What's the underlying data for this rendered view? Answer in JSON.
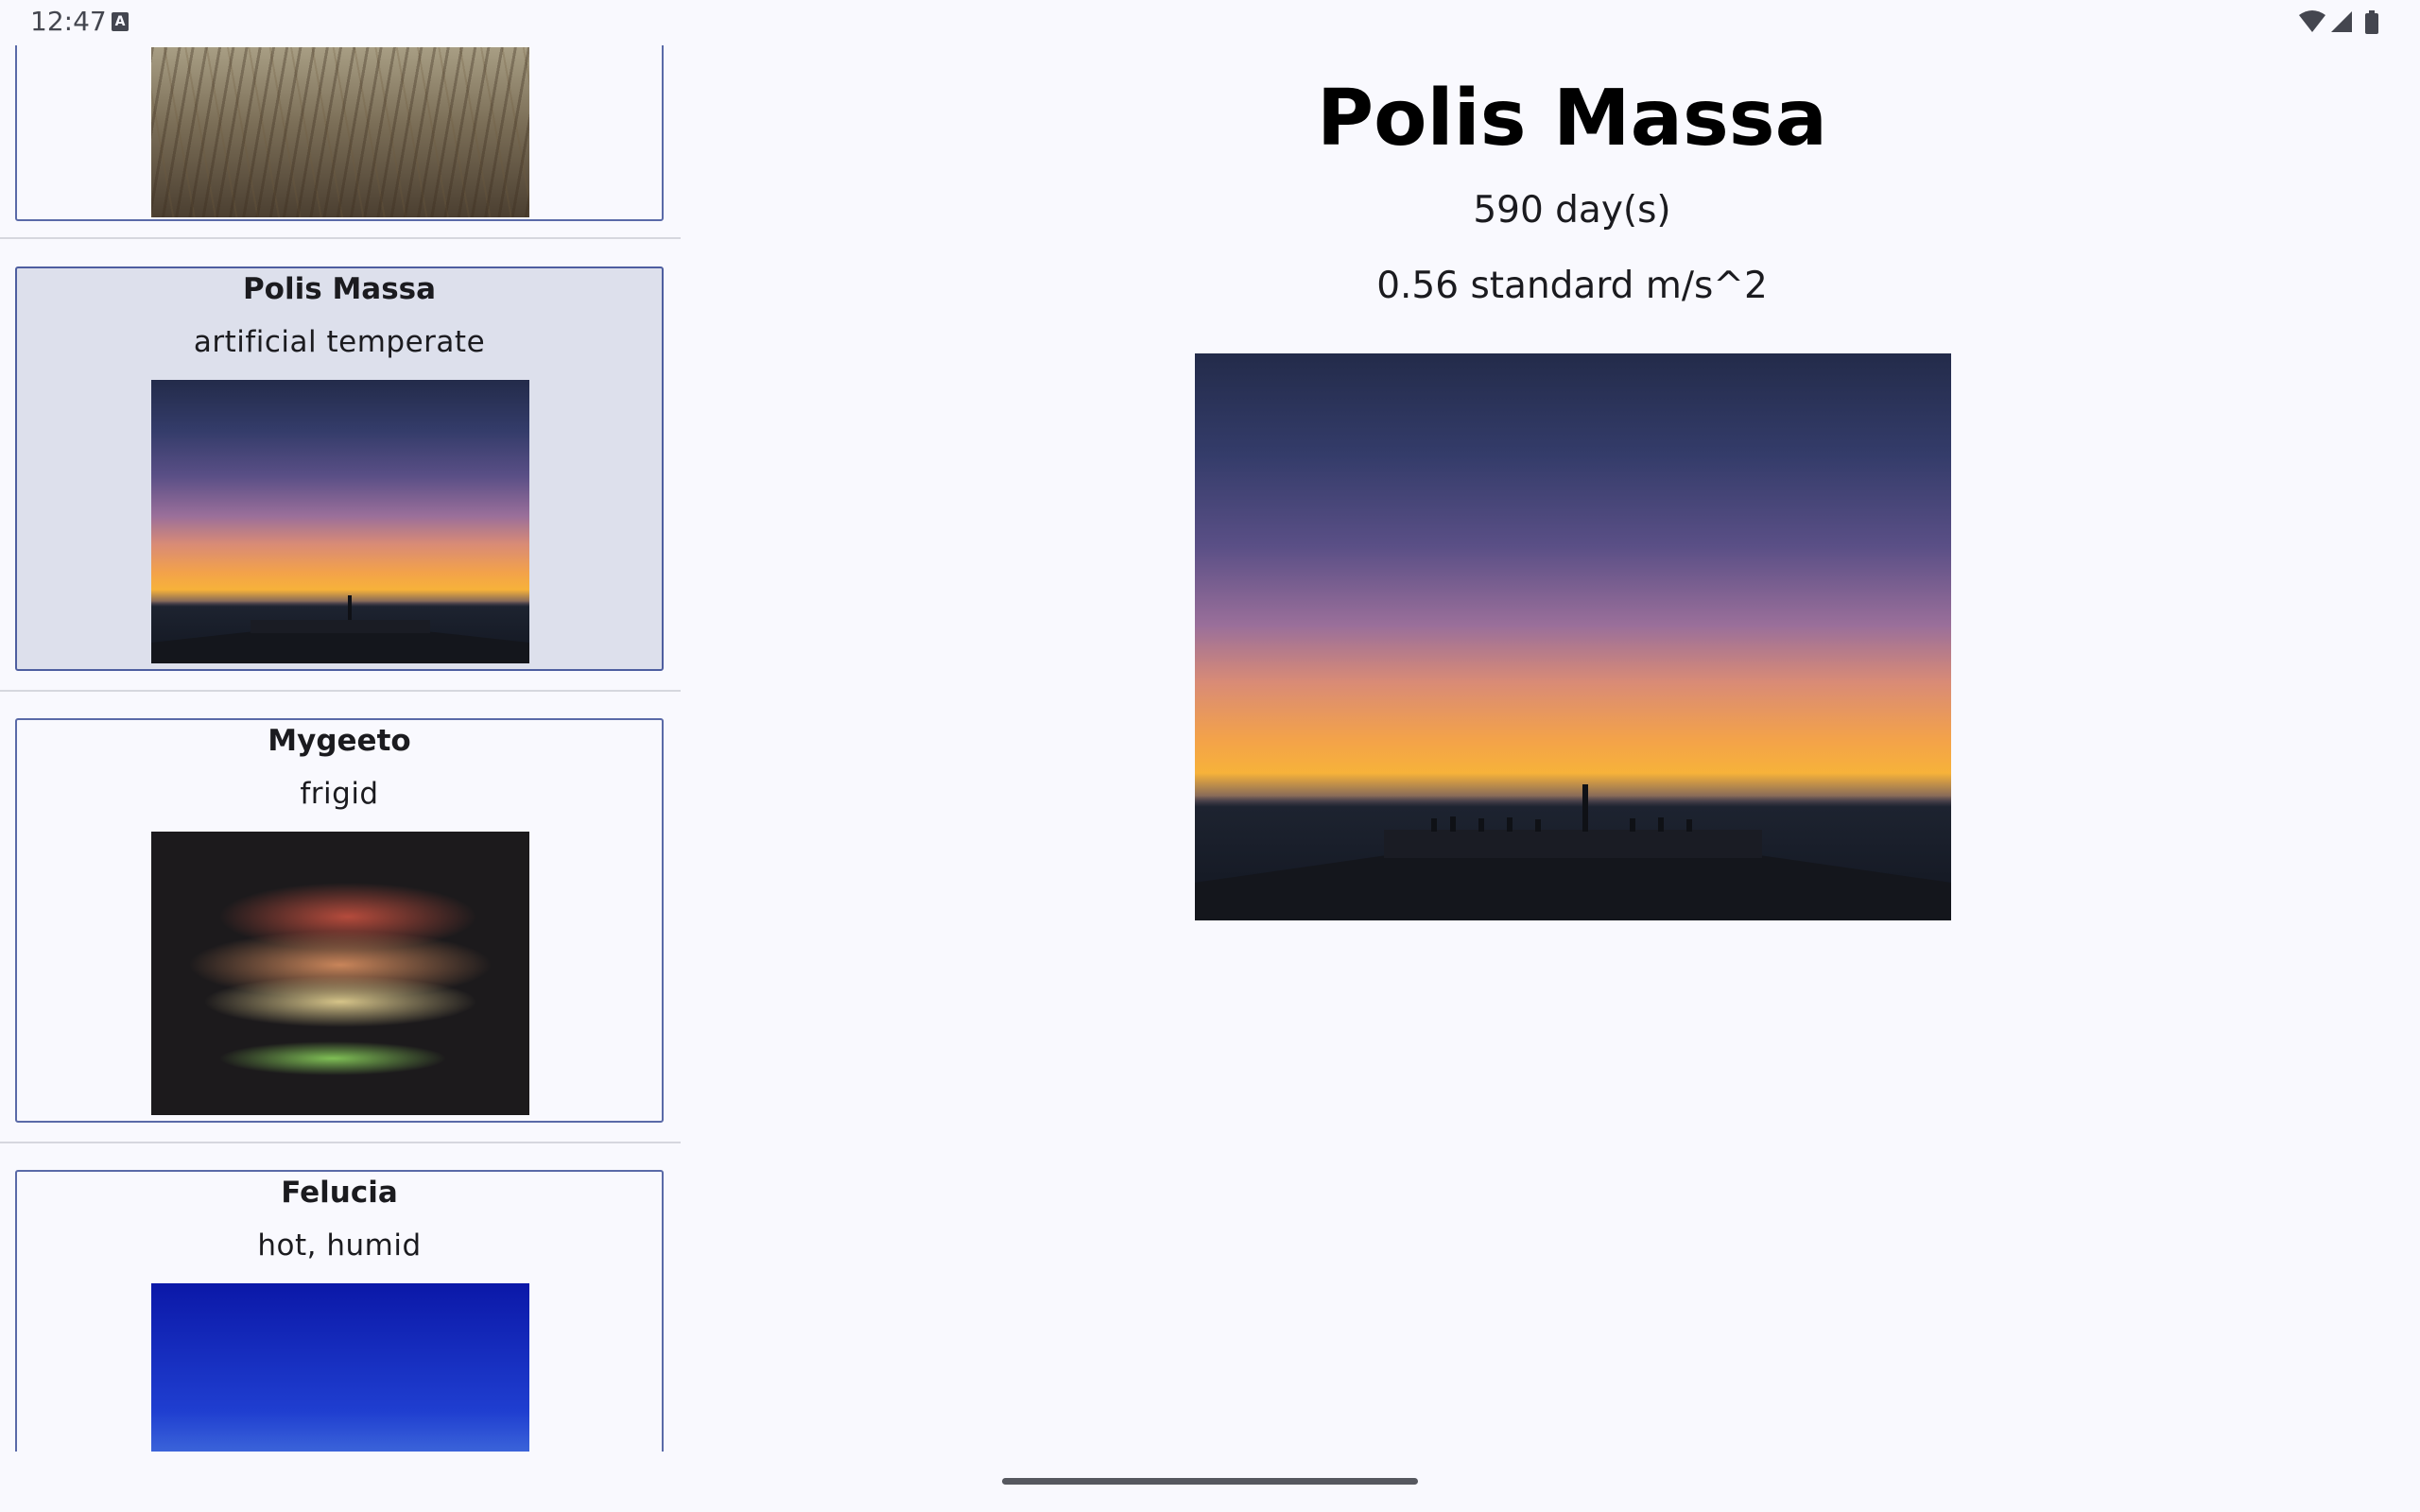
{
  "status_bar": {
    "time": "12:47",
    "a_icon": "A"
  },
  "list": {
    "items": [
      {
        "title": "",
        "subtitle": "",
        "image": "grass-field-image",
        "selected": false
      },
      {
        "title": "Polis Massa",
        "subtitle": "artificial temperate",
        "image": "pier-sunset-image",
        "selected": true
      },
      {
        "title": "Mygeeto",
        "subtitle": "frigid",
        "image": "dried-leaf-image",
        "selected": false
      },
      {
        "title": "Felucia",
        "subtitle": "hot, humid",
        "image": "blue-sky-image",
        "selected": false
      }
    ]
  },
  "detail": {
    "title": "Polis Massa",
    "orbital_period": "590 day(s)",
    "gravity": "0.56 standard m/s^2",
    "image": "pier-sunset-image"
  },
  "colors": {
    "background": "#f9f9fe",
    "card_border": "#5a6aa8",
    "selected_card": "#dde0ec"
  }
}
